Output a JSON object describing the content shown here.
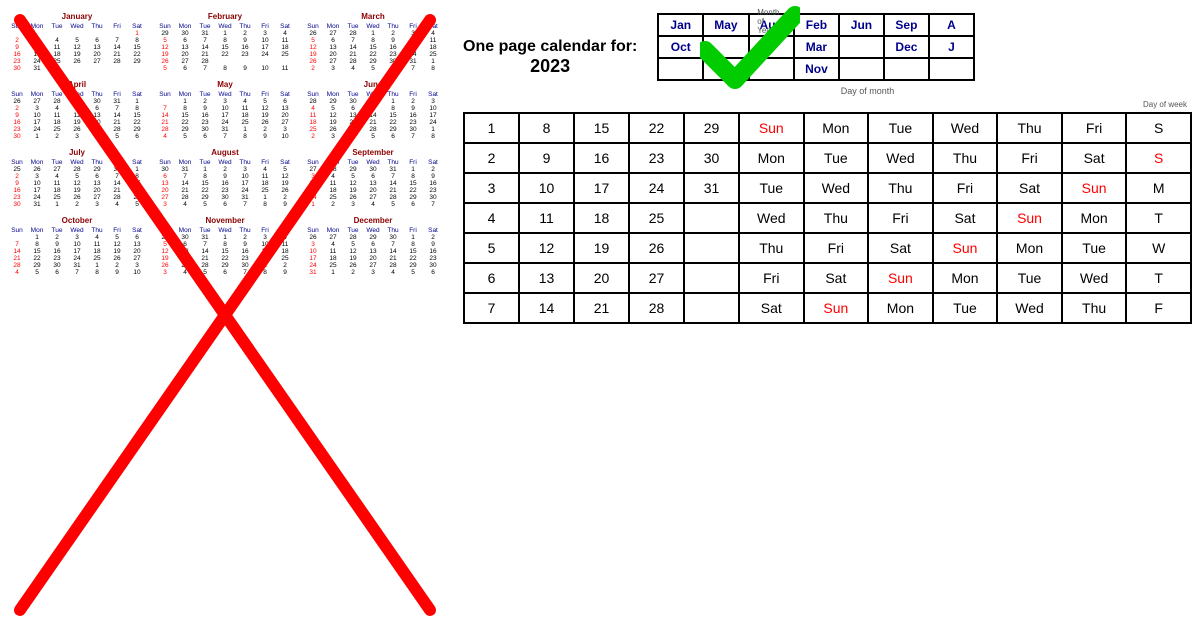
{
  "title": "One page calendar for:",
  "year": "2023",
  "checkmark_color": "#00CC00",
  "months_header": [
    {
      "label": "Jan",
      "row": 1
    },
    {
      "label": "May",
      "row": 1
    },
    {
      "label": "Aug",
      "row": 1
    },
    {
      "label": "Feb",
      "row": 1
    },
    {
      "label": "Jun",
      "row": 1
    },
    {
      "label": "Sep",
      "row": 1
    },
    {
      "label": "A",
      "row": 1
    },
    {
      "label": "Oct",
      "row": 2
    },
    {
      "label": "Mar",
      "row": 2
    },
    {
      "label": "Dec",
      "row": 2
    },
    {
      "label": "J",
      "row": 2
    },
    {
      "label": "Nov",
      "row": 3
    }
  ],
  "col_labels": {
    "day_of_month": "Day of month",
    "day_of_week": "Day of week",
    "month_of_year": "Month\nof\nYear"
  },
  "rows": [
    {
      "date": "1",
      "dates": [
        "8",
        "15",
        "22",
        "29"
      ],
      "days": [
        "Sun",
        "Mon",
        "Tue",
        "Wed",
        "Thu",
        "Fri",
        "S"
      ]
    },
    {
      "date": "2",
      "dates": [
        "9",
        "16",
        "23",
        "30"
      ],
      "days": [
        "Mon",
        "Tue",
        "Wed",
        "Thu",
        "Fri",
        "Sat",
        "S"
      ]
    },
    {
      "date": "3",
      "dates": [
        "10",
        "17",
        "24",
        "31"
      ],
      "days": [
        "Tue",
        "Wed",
        "Thu",
        "Fri",
        "Sat",
        "Sun",
        "M"
      ]
    },
    {
      "date": "4",
      "dates": [
        "11",
        "18",
        "25",
        ""
      ],
      "days": [
        "Wed",
        "Thu",
        "Fri",
        "Sat",
        "Sun",
        "Mon",
        "T"
      ]
    },
    {
      "date": "5",
      "dates": [
        "12",
        "19",
        "26",
        ""
      ],
      "days": [
        "Thu",
        "Fri",
        "Sat",
        "Sun",
        "Mon",
        "Tue",
        "W"
      ]
    },
    {
      "date": "6",
      "dates": [
        "13",
        "20",
        "27",
        ""
      ],
      "days": [
        "Fri",
        "Sat",
        "Sun",
        "Mon",
        "Tue",
        "Wed",
        "T"
      ]
    },
    {
      "date": "7",
      "dates": [
        "14",
        "21",
        "28",
        ""
      ],
      "days": [
        "Sat",
        "Sun",
        "Mon",
        "Tue",
        "Wed",
        "Thu",
        "F"
      ]
    }
  ],
  "mini_months": [
    {
      "name": "January",
      "rows": [
        [
          "",
          "",
          "",
          "",
          "",
          "",
          "1"
        ],
        [
          "2",
          "3",
          "4",
          "5",
          "6",
          "7",
          "8"
        ],
        [
          "9",
          "10",
          "11",
          "12",
          "13",
          "14",
          "15"
        ],
        [
          "16",
          "17",
          "18",
          "19",
          "20",
          "21",
          "22"
        ],
        [
          "23",
          "24",
          "25",
          "26",
          "27",
          "28",
          "29"
        ],
        [
          "30",
          "31",
          "",
          "",
          "",
          "",
          ""
        ]
      ]
    },
    {
      "name": "February",
      "header_row": [
        "29",
        "30",
        "31",
        "1",
        "2",
        "3",
        "4"
      ],
      "rows": [
        [
          "5",
          "6",
          "7",
          "8",
          "9",
          "10",
          "11"
        ],
        [
          "12",
          "13",
          "14",
          "15",
          "16",
          "17",
          "18"
        ],
        [
          "19",
          "20",
          "21",
          "22",
          "23",
          "24",
          "25"
        ],
        [
          "26",
          "27",
          "28",
          "",
          "",
          "",
          ""
        ],
        [
          "5",
          "6",
          "7",
          "8",
          "9",
          "10",
          "11"
        ]
      ]
    },
    {
      "name": "March",
      "rows": [
        [
          "26",
          "27",
          "28",
          "1",
          "2",
          "3",
          "4"
        ],
        [
          "5",
          "6",
          "7",
          "8",
          "9",
          "10",
          "11"
        ],
        [
          "12",
          "13",
          "14",
          "15",
          "16",
          "17",
          "18"
        ],
        [
          "19",
          "20",
          "21",
          "22",
          "23",
          "24",
          "25"
        ],
        [
          "26",
          "27",
          "28",
          "29",
          "30",
          "31",
          "1"
        ],
        [
          "2",
          "3",
          "4",
          "5",
          "6",
          "7",
          "8"
        ]
      ]
    }
  ]
}
